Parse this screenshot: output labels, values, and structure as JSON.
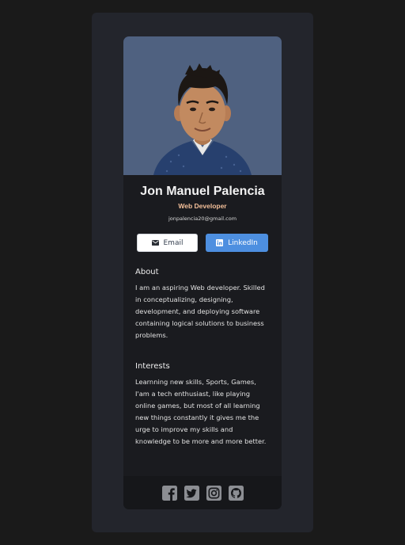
{
  "profile": {
    "name": "Jon Manuel Palencia",
    "role": "Web Developer",
    "email": "jonpalencia20@gmail.com"
  },
  "buttons": {
    "email_label": "Email",
    "linkedin_label": "LinkedIn"
  },
  "about": {
    "title": "About",
    "body": "I am an aspiring Web developer. Skilled in conceptualizing, designing, development, and deploying software containing logical solutions to business problems."
  },
  "interests": {
    "title": "Interests",
    "body": "Learnning new skills, Sports, Games, I'am a tech enthusiast, like playing online games, but most of all learning new things constantly it gives me the urge to improve my skills and knowledge to be more and more better."
  },
  "footer": {
    "icons": [
      "facebook-icon",
      "twitter-icon",
      "instagram-icon",
      "github-icon"
    ]
  },
  "colors": {
    "page_bg": "#1a1a1a",
    "frame_bg": "#23252c",
    "card_bg": "#1a1b1f",
    "accent_role": "#f3bf99",
    "linkedin_blue": "#4d8fe0",
    "photo_bg": "#4f6180"
  }
}
